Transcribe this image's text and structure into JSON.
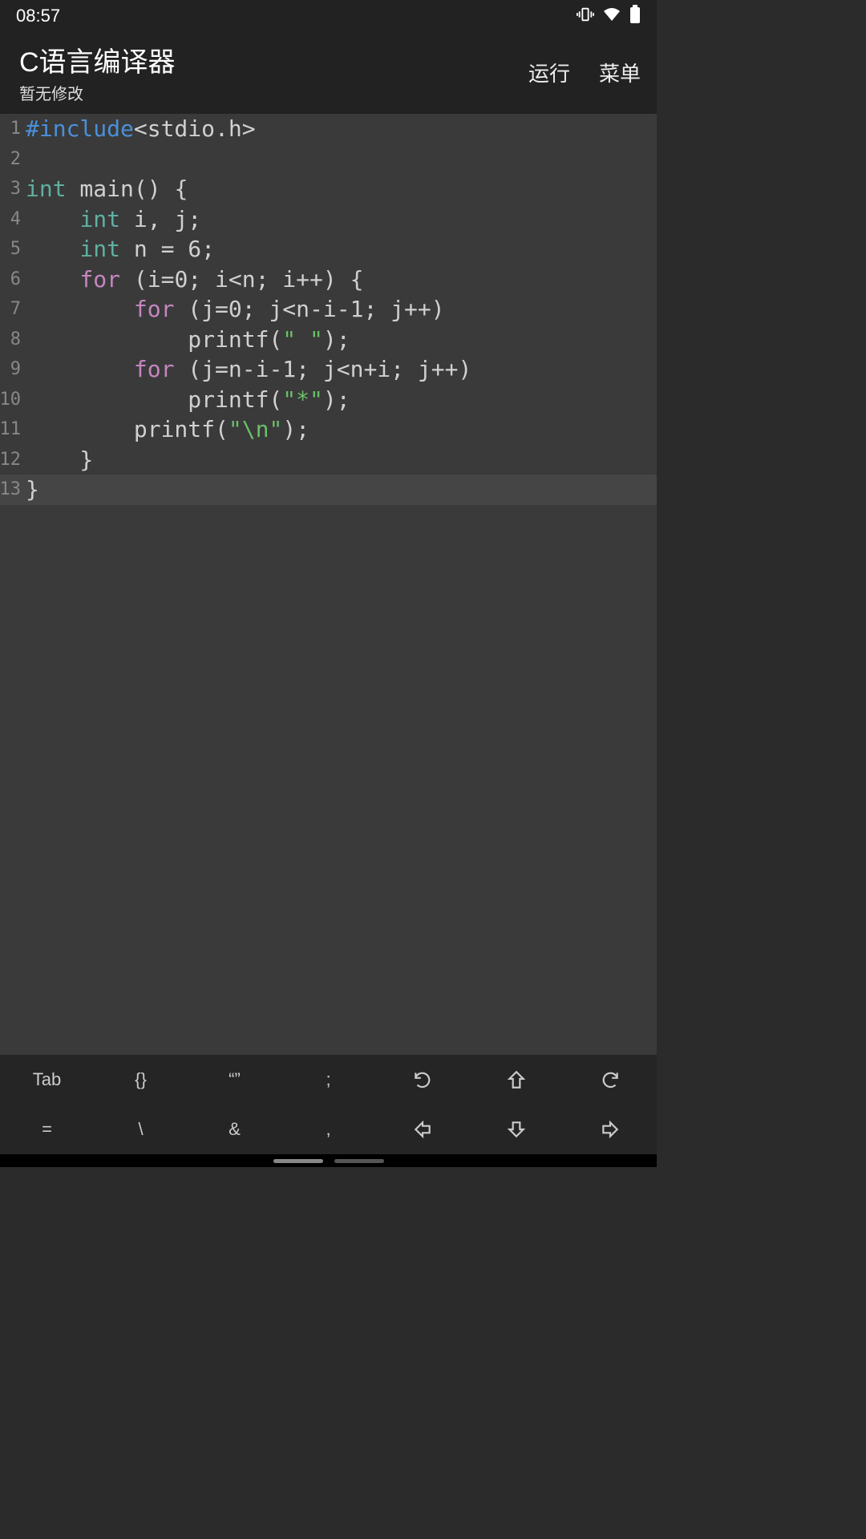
{
  "status": {
    "time": "08:57"
  },
  "header": {
    "title": "C语言编译器",
    "subtitle": "暂无修改",
    "actions": {
      "run": "运行",
      "menu": "菜单"
    }
  },
  "code": {
    "lines": [
      {
        "n": "1",
        "tokens": [
          [
            "preproc",
            "#include"
          ],
          [
            "plain",
            "<stdio.h>"
          ]
        ]
      },
      {
        "n": "2",
        "tokens": []
      },
      {
        "n": "3",
        "tokens": [
          [
            "type",
            "int"
          ],
          [
            "plain",
            " main() {"
          ]
        ]
      },
      {
        "n": "4",
        "tokens": [
          [
            "plain",
            "    "
          ],
          [
            "type",
            "int"
          ],
          [
            "plain",
            " i, j;"
          ]
        ]
      },
      {
        "n": "5",
        "tokens": [
          [
            "plain",
            "    "
          ],
          [
            "type",
            "int"
          ],
          [
            "plain",
            " n = 6;"
          ]
        ]
      },
      {
        "n": "6",
        "tokens": [
          [
            "plain",
            "    "
          ],
          [
            "keyword",
            "for"
          ],
          [
            "plain",
            " (i=0; i<n; i++) {"
          ]
        ]
      },
      {
        "n": "7",
        "tokens": [
          [
            "plain",
            "        "
          ],
          [
            "keyword",
            "for"
          ],
          [
            "plain",
            " (j=0; j<n-i-1; j++)"
          ]
        ]
      },
      {
        "n": "8",
        "tokens": [
          [
            "plain",
            "            printf("
          ],
          [
            "string",
            "\" \""
          ],
          [
            "plain",
            ");"
          ]
        ]
      },
      {
        "n": "9",
        "tokens": [
          [
            "plain",
            "        "
          ],
          [
            "keyword",
            "for"
          ],
          [
            "plain",
            " (j=n-i-1; j<n+i; j++)"
          ]
        ]
      },
      {
        "n": "10",
        "tokens": [
          [
            "plain",
            "            printf("
          ],
          [
            "string",
            "\"*\""
          ],
          [
            "plain",
            ");"
          ]
        ]
      },
      {
        "n": "11",
        "tokens": [
          [
            "plain",
            "        printf("
          ],
          [
            "string",
            "\"\\n\""
          ],
          [
            "plain",
            ");"
          ]
        ]
      },
      {
        "n": "12",
        "tokens": [
          [
            "plain",
            "    }"
          ]
        ]
      },
      {
        "n": "13",
        "tokens": [
          [
            "plain",
            "}"
          ]
        ],
        "hl": true
      }
    ]
  },
  "toolbar": {
    "keys": [
      "Tab",
      "{}",
      "“”",
      ";",
      "undo-icon",
      "up-icon",
      "redo-icon",
      "=",
      "\\",
      "&",
      ",",
      "left-icon",
      "down-icon",
      "right-icon"
    ]
  }
}
